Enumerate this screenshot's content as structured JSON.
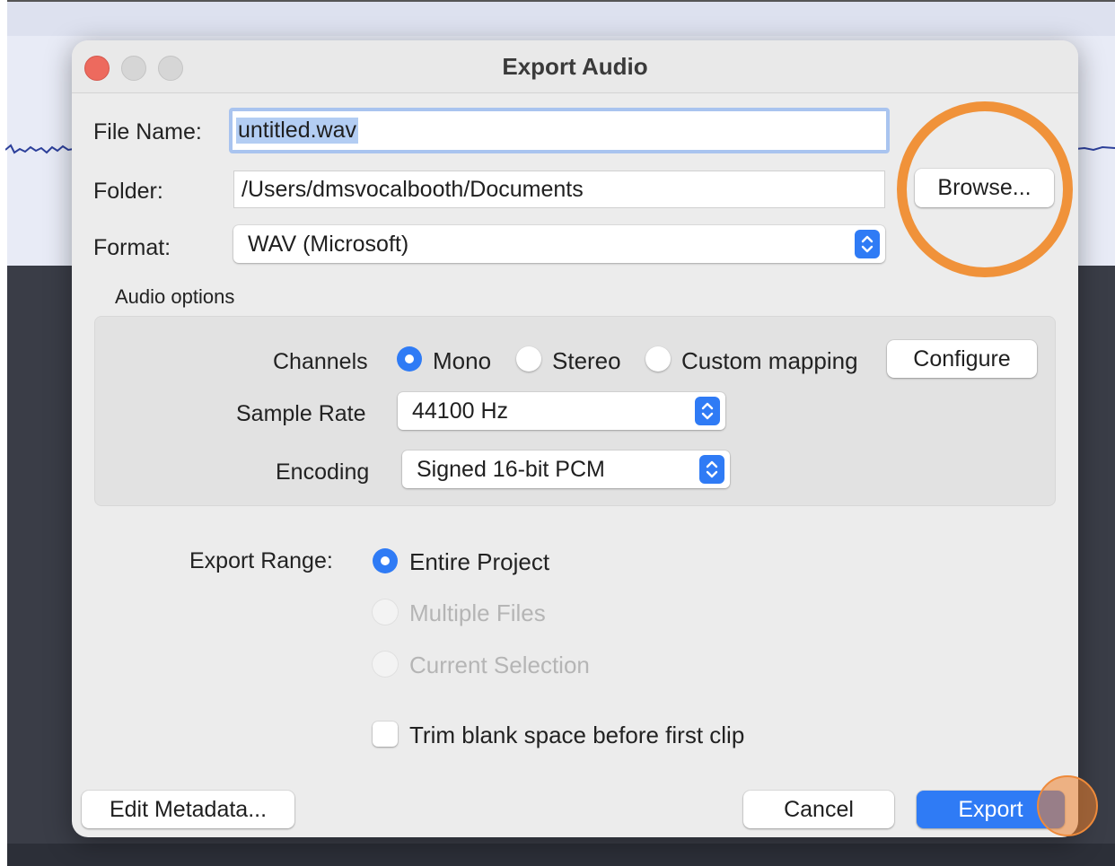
{
  "dialog": {
    "title": "Export Audio"
  },
  "file_name": {
    "label": "File Name:",
    "value": "untitled.wav"
  },
  "folder": {
    "label": "Folder:",
    "value": "/Users/dmsvocalbooth/Documents",
    "browse_label": "Browse..."
  },
  "format": {
    "label": "Format:",
    "selected": "WAV (Microsoft)"
  },
  "audio_options": {
    "heading": "Audio options",
    "channels_label": "Channels",
    "channel_options": [
      "Mono",
      "Stereo",
      "Custom mapping"
    ],
    "channel_selected": "Mono",
    "configure_label": "Configure",
    "sample_rate_label": "Sample Rate",
    "sample_rate_selected": "44100 Hz",
    "encoding_label": "Encoding",
    "encoding_selected": "Signed 16-bit PCM"
  },
  "export_range": {
    "label": "Export Range:",
    "options": [
      "Entire Project",
      "Multiple Files",
      "Current Selection"
    ],
    "selected": "Entire Project"
  },
  "trim": {
    "label": "Trim blank space before first clip",
    "checked": false
  },
  "footer": {
    "edit_metadata_label": "Edit Metadata...",
    "cancel_label": "Cancel",
    "export_label": "Export"
  },
  "colors": {
    "accent": "#2f7bf5",
    "annotation": "#f0923a",
    "close_button": "#ed6a5e"
  }
}
